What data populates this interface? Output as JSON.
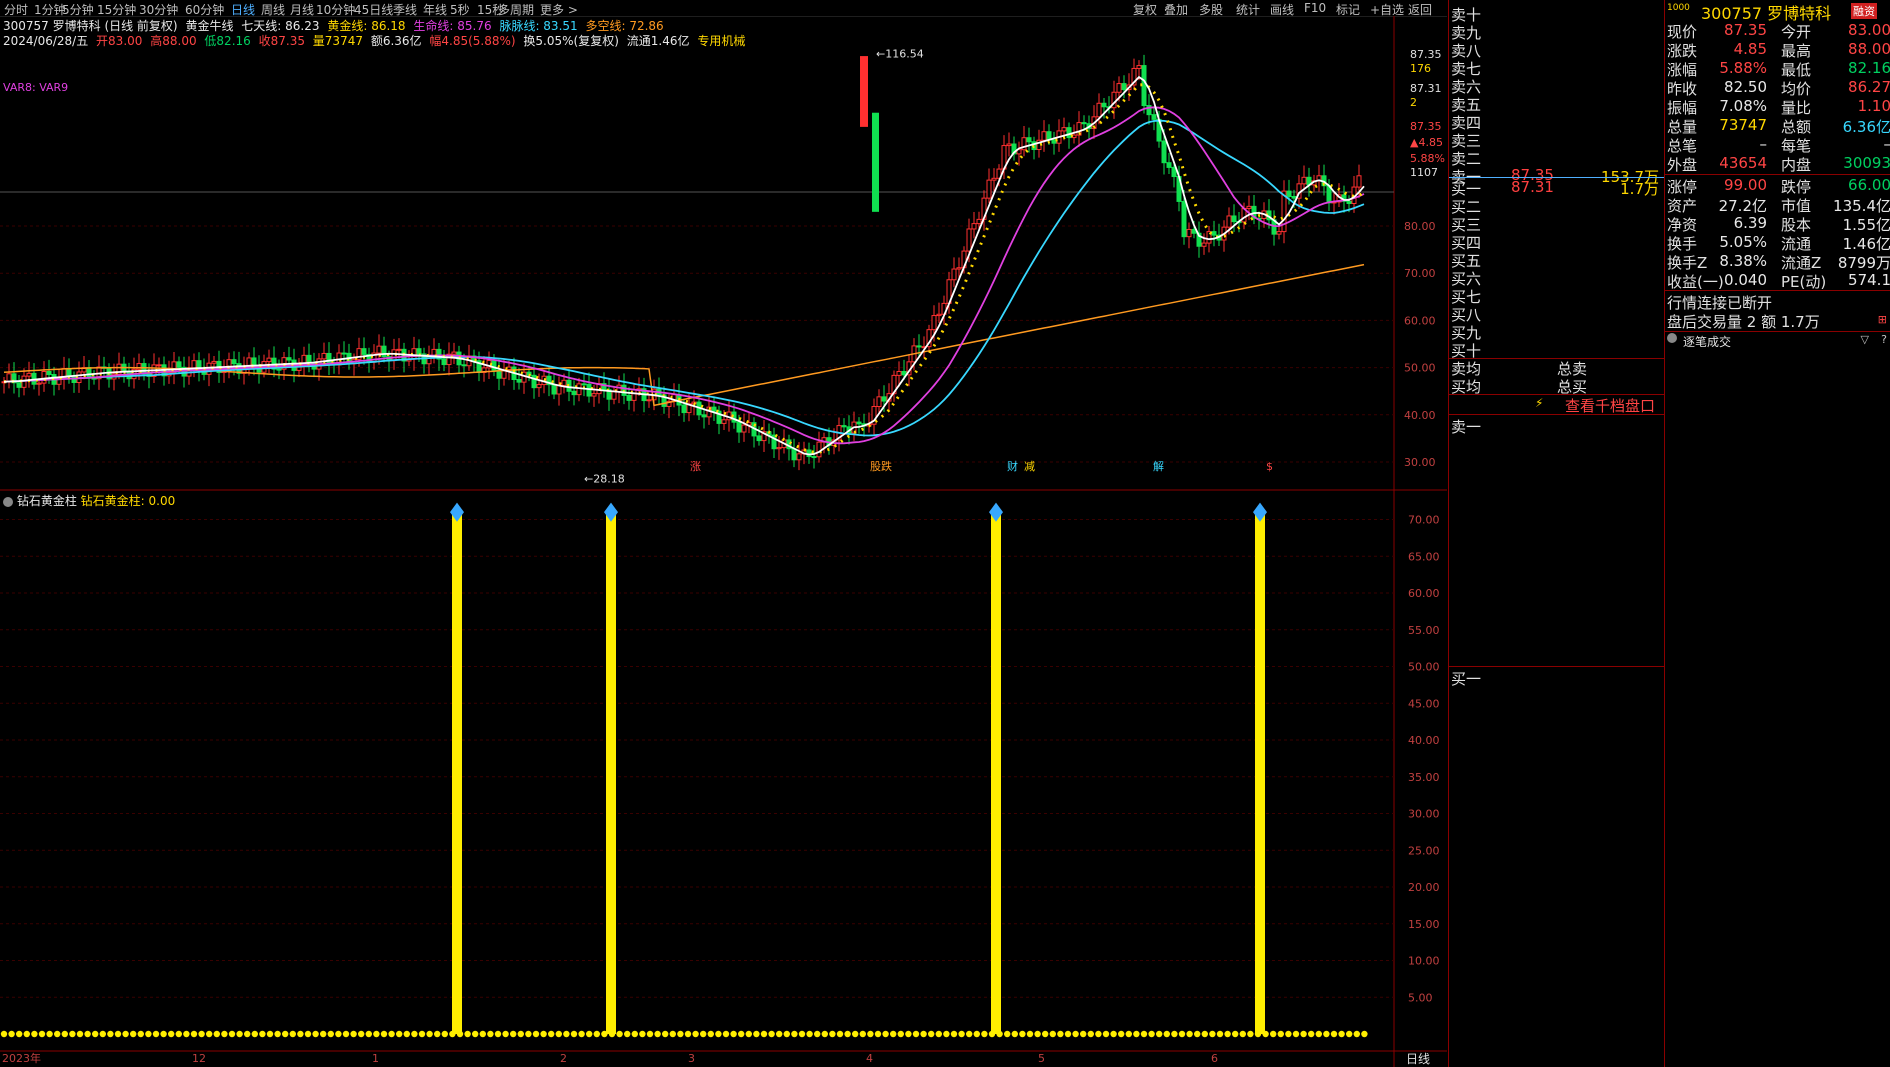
{
  "toolbar": {
    "periods": [
      "分时",
      "1分钟",
      "5分钟",
      "15分钟",
      "30分钟",
      "60分钟",
      "日线",
      "周线",
      "月线",
      "10分钟",
      "45日线",
      "季线",
      "年线",
      "5秒",
      "15秒",
      "多周期",
      "更多 >"
    ],
    "active_period": "日线",
    "tools": [
      "复权",
      "叠加",
      "多股",
      "统计",
      "画线",
      "F10",
      "标记",
      "+自选",
      "返回"
    ]
  },
  "header": {
    "stock": "300757 罗博特科 (日线 前复权)",
    "indicator_name": "黄金牛线",
    "qitian": "七天线: 86.23",
    "huangjin": "黄金线: 86.18",
    "shengming": "生命线: 85.76",
    "fuming": "脉脉线: 83.51",
    "duokong": "多空线: 72.86",
    "date": "2024/06/28/五",
    "open": "开83.00",
    "high": "高88.00",
    "low": "低82.16",
    "close": "收87.35",
    "volume": "量73747",
    "amount": "额6.36亿",
    "change": "幅4.85(5.88%)",
    "turnover": "换5.05%(复复权)",
    "float": "流通1.46亿",
    "tag": "专用机械",
    "var_label": "VAR8: VAR9"
  },
  "price_axis": {
    "top_labels": [
      "87.35",
      "176",
      "87.31",
      "2",
      "87.35",
      "▲4.85",
      "5.88%",
      "1107"
    ],
    "ticks": [
      "80.00",
      "70.00",
      "60.00",
      "50.00",
      "40.00",
      "30.00"
    ]
  },
  "annotations": {
    "peak": "116.54",
    "trough": "28.18"
  },
  "events": [
    "涨",
    "股跌",
    "财",
    "减",
    "解",
    "$"
  ],
  "sub_chart": {
    "title": "钻石黄金柱",
    "label": "钻石黄金柱: 0.00",
    "ticks": [
      "70.00",
      "65.00",
      "60.00",
      "55.00",
      "50.00",
      "45.00",
      "40.00",
      "35.00",
      "30.00",
      "25.00",
      "20.00",
      "15.00",
      "10.00",
      "5.00"
    ]
  },
  "date_axis": [
    "2023年",
    "12",
    "1",
    "2",
    "3",
    "4",
    "5",
    "6"
  ],
  "bottom_label": "日线",
  "orderbook": {
    "sells": [
      "卖十",
      "卖九",
      "卖八",
      "卖七",
      "卖六",
      "卖五",
      "卖四",
      "卖三",
      "卖二",
      "卖一"
    ],
    "sell1_price": "87.35",
    "sell1_vol": "153.7万",
    "buys": [
      "买一",
      "买二",
      "买三",
      "买四",
      "买五",
      "买六",
      "买七",
      "买八",
      "买九",
      "买十"
    ],
    "buy1_price": "87.31",
    "buy1_vol": "1.7万",
    "avg_sell": "卖均",
    "avg_buy": "买均",
    "total_sell": "总卖",
    "total_buy": "总买",
    "link": "查看千档盘口",
    "sell_one": "卖一",
    "buy_one": "买一"
  },
  "quote": {
    "code": "300757",
    "name": "罗博特科",
    "badge": "融资",
    "mini": "1000",
    "rows": [
      {
        "l1": "现价",
        "v1": "87.35",
        "c1": "red",
        "l2": "今开",
        "v2": "83.00",
        "c2": "red"
      },
      {
        "l1": "涨跌",
        "v1": "4.85",
        "c1": "red",
        "l2": "最高",
        "v2": "88.00",
        "c2": "red"
      },
      {
        "l1": "涨幅",
        "v1": "5.88%",
        "c1": "red",
        "l2": "最低",
        "v2": "82.16",
        "c2": "green"
      },
      {
        "l1": "昨收",
        "v1": "82.50",
        "c1": "white",
        "l2": "均价",
        "v2": "86.27",
        "c2": "red"
      },
      {
        "l1": "振幅",
        "v1": "7.08%",
        "c1": "white",
        "l2": "量比",
        "v2": "1.10",
        "c2": "red"
      },
      {
        "l1": "总量",
        "v1": "73747",
        "c1": "yellow",
        "l2": "总额",
        "v2": "6.36亿",
        "c2": "cyan"
      },
      {
        "l1": "总笔",
        "v1": "–",
        "c1": "white",
        "l2": "每笔",
        "v2": "–",
        "c2": "white"
      },
      {
        "l1": "外盘",
        "v1": "43654",
        "c1": "red",
        "l2": "内盘",
        "v2": "30093",
        "c2": "green"
      }
    ],
    "rows2": [
      {
        "l1": "涨停",
        "v1": "99.00",
        "c1": "red",
        "l2": "跌停",
        "v2": "66.00",
        "c2": "green"
      },
      {
        "l1": "资产",
        "v1": "27.2亿",
        "c1": "white",
        "l2": "市值",
        "v2": "135.4亿",
        "c2": "white"
      },
      {
        "l1": "净资",
        "v1": "6.39",
        "c1": "white",
        "l2": "股本",
        "v2": "1.55亿",
        "c2": "white"
      },
      {
        "l1": "换手",
        "v1": "5.05%",
        "c1": "white",
        "l2": "流通",
        "v2": "1.46亿",
        "c2": "white"
      },
      {
        "l1": "换手Z",
        "v1": "8.38%",
        "c1": "white",
        "l2": "流通Z",
        "v2": "8799万",
        "c2": "white"
      },
      {
        "l1": "收益(一)",
        "v1": "0.040",
        "c1": "white",
        "l2": "PE(动)",
        "v2": "574.1",
        "c2": "white"
      }
    ],
    "status": "行情连接已断开",
    "after_hours": "盘后交易量 2 额 1.7万",
    "ticks_title": "逐笔成交"
  }
}
